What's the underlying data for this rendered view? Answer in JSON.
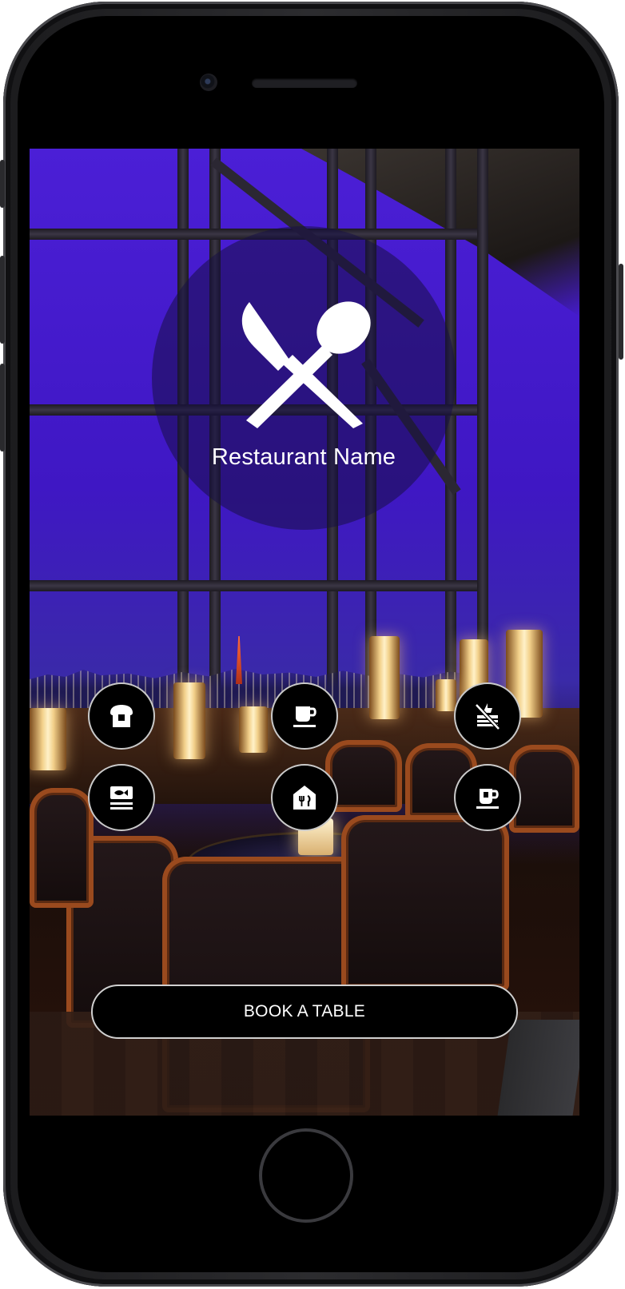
{
  "header": {
    "restaurant_name": "Restaurant Name",
    "logo_icon": "knife-spoon-icon"
  },
  "categories": [
    {
      "icon": "toast-icon"
    },
    {
      "icon": "coffee-cup-icon"
    },
    {
      "icon": "no-food-icon"
    },
    {
      "icon": "fish-plate-icon"
    },
    {
      "icon": "restaurant-house-icon"
    },
    {
      "icon": "cup-on-saucer-icon"
    }
  ],
  "cta": {
    "book_label": "BOOK A TABLE"
  },
  "colors": {
    "button_bg": "#000000",
    "button_border": "#d0d0d0",
    "text": "#ffffff",
    "overlay": "#180e46"
  }
}
